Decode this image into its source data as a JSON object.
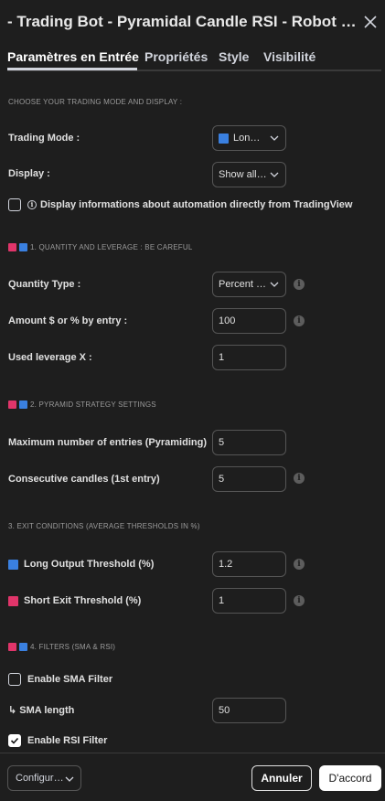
{
  "dialog": {
    "title": "- Trading Bot - Pyramidal Candle RSI - Robot Strat…",
    "close_icon": "close-icon"
  },
  "tabs": [
    {
      "label": "Paramètres en Entrée",
      "active": true
    },
    {
      "label": "Propriétés",
      "active": false
    },
    {
      "label": "Style",
      "active": false
    },
    {
      "label": "Visibilité",
      "active": false
    }
  ],
  "sections": {
    "mode": "CHOOSE YOUR TRADING MODE AND DISPLAY :",
    "quantity": "1. QUANTITY AND LEVERAGE : BE CAREFUL",
    "pyramid": "2. PYRAMID STRATEGY SETTINGS",
    "exit": "3. EXIT CONDITIONS (AVERAGE THRESHOLDS IN %)",
    "filters": "4. FILTERS (SMA & RSI)"
  },
  "fields": {
    "trading_mode": {
      "label": "Trading Mode :",
      "value": "Lon…"
    },
    "display": {
      "label": "Display :",
      "value": "Show all…"
    },
    "display_info": {
      "label": "Display informations about automation directly from TradingView",
      "checked": false
    },
    "quantity_type": {
      "label": "Quantity Type :",
      "value": "Percent …"
    },
    "amount": {
      "label": "Amount $ or % by entry :",
      "value": "100"
    },
    "leverage": {
      "label": "Used leverage X :",
      "value": "1"
    },
    "max_entries": {
      "label": "Maximum number of entries (Pyramiding)",
      "value": "5"
    },
    "consecutive": {
      "label": "Consecutive candles (1st entry)",
      "value": "5"
    },
    "long_output": {
      "label": "Long Output Threshold (%)",
      "value": "1.2"
    },
    "short_exit": {
      "label": "Short Exit Threshold (%)",
      "value": "1"
    },
    "sma_filter": {
      "label": "Enable SMA Filter",
      "checked": false
    },
    "sma_length": {
      "label": "↳ SMA length",
      "value": "50"
    },
    "rsi_filter": {
      "label": "Enable RSI Filter",
      "checked": true
    }
  },
  "footer": {
    "config": "Configur…",
    "cancel": "Annuler",
    "ok": "D'accord"
  },
  "colors": {
    "background": "#1e1e1e",
    "pink_marker": "#e0356a",
    "blue_marker": "#3a80e0",
    "border": "#555555"
  }
}
